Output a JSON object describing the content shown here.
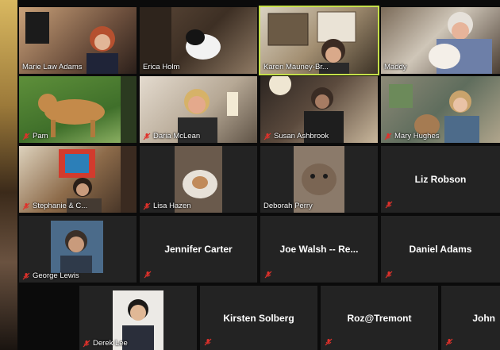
{
  "participants": [
    {
      "name": "Marie Law Adams",
      "muted": false,
      "video": true
    },
    {
      "name": "Erica Holm",
      "muted": false,
      "video": true
    },
    {
      "name": "Karen Mauney-Br...",
      "muted": false,
      "video": true,
      "active_speaker": true
    },
    {
      "name": "Maddy",
      "muted": false,
      "video": true
    },
    {
      "name": "Pam",
      "muted": true,
      "video": true
    },
    {
      "name": "Daria McLean",
      "muted": true,
      "video": true
    },
    {
      "name": "Susan Ashbrook",
      "muted": true,
      "video": true
    },
    {
      "name": "Mary Hughes",
      "muted": true,
      "video": true
    },
    {
      "name": "Stephanie & C...",
      "muted": true,
      "video": true
    },
    {
      "name": "Lisa Hazen",
      "muted": true,
      "video": true
    },
    {
      "name": "Deborah Perry",
      "muted": false,
      "video": true
    },
    {
      "name": "Liz Robson",
      "muted": true,
      "video": false
    },
    {
      "name": "George Lewis",
      "muted": true,
      "video": true
    },
    {
      "name": "Jennifer Carter",
      "muted": true,
      "video": false
    },
    {
      "name": "Joe Walsh -- Re...",
      "muted": true,
      "video": false
    },
    {
      "name": "Daniel Adams",
      "muted": true,
      "video": false
    },
    {
      "name": "Derek Lee",
      "muted": true,
      "video": true
    },
    {
      "name": "Kirsten Solberg",
      "muted": true,
      "video": false
    },
    {
      "name": "Roz@Tremont",
      "muted": true,
      "video": false
    },
    {
      "name": "John",
      "muted": true,
      "video": false
    }
  ],
  "colors": {
    "active_border": "#c6e04a",
    "muted_icon": "#e0312b",
    "tile_bg": "#232323"
  }
}
